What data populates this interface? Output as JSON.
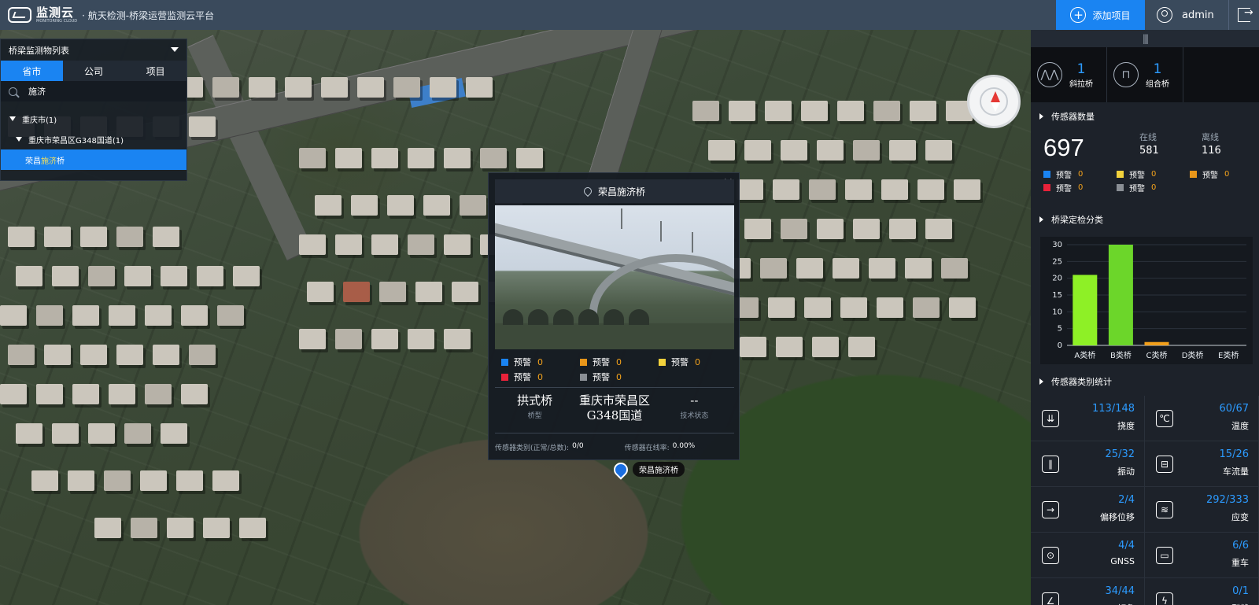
{
  "header": {
    "brand_cn": "监测云",
    "brand_en": "MONITORING CLOUD",
    "title": "· 航天检测-桥梁运营监测云平台",
    "add_project": "添加项目",
    "user": "admin"
  },
  "list_panel": {
    "title": "桥梁监测物列表",
    "tabs": [
      {
        "label": "省市",
        "active": true
      },
      {
        "label": "公司",
        "active": false
      },
      {
        "label": "项目",
        "active": false
      }
    ],
    "search_value": "施济",
    "tree": [
      {
        "level": 1,
        "label": "重庆市(1)"
      },
      {
        "level": 2,
        "label": "重庆市荣昌区G348国道(1)"
      },
      {
        "level": 3,
        "label_pre": "荣昌",
        "label_hl": "施济",
        "label_post": "桥"
      }
    ]
  },
  "popup": {
    "title": "荣昌施济桥",
    "close": "×",
    "warnings": [
      {
        "color": "#1a84f2",
        "label": "预警",
        "count": "0"
      },
      {
        "color": "#e8961a",
        "label": "预警",
        "count": "0"
      },
      {
        "color": "#f2d23c",
        "label": "预警",
        "count": "0"
      },
      {
        "color": "#e8223a",
        "label": "预警",
        "count": "0"
      },
      {
        "color": "#8a8f95",
        "label": "预警",
        "count": "0"
      }
    ],
    "bridge_type": "拱式桥",
    "bridge_type_label": "桥型",
    "location": "重庆市荣昌区G348国道",
    "tech_status": "--",
    "tech_status_label": "技术状态",
    "sensor_ratio_label": "传感器类别(正常/总数):",
    "sensor_ratio": "0/0",
    "online_rate_label": "传感器在线率:",
    "online_rate": "0.00%"
  },
  "marker": {
    "label": "荣昌施济桥"
  },
  "right": {
    "bridge_types": [
      {
        "icon": "cable-stayed-bridge-icon",
        "count": "1",
        "label": "斜拉桥"
      },
      {
        "icon": "composite-bridge-icon",
        "count": "1",
        "label": "组合桥"
      }
    ],
    "sensor_section": "传感器数量",
    "sensor_total": "697",
    "online_label": "在线",
    "online": "581",
    "offline_label": "离线",
    "offline": "116",
    "sensor_warnings": [
      {
        "color": "#1a84f2",
        "label": "预警",
        "count": "0"
      },
      {
        "color": "#f2d23c",
        "label": "预警",
        "count": "0"
      },
      {
        "color": "#e8961a",
        "label": "预警",
        "count": "0"
      },
      {
        "color": "#e8223a",
        "label": "预警",
        "count": "0"
      },
      {
        "color": "#8a8f95",
        "label": "预警",
        "count": "0"
      }
    ],
    "classify_section": "桥梁定检分类",
    "type_section": "传感器类别统计",
    "sensor_types": [
      {
        "icon": "deflection-icon",
        "value": "113/148",
        "label": "挠度"
      },
      {
        "icon": "thermometer-icon",
        "value": "60/67",
        "label": "温度"
      },
      {
        "icon": "vibration-icon",
        "value": "25/32",
        "label": "振动"
      },
      {
        "icon": "car-icon",
        "value": "15/26",
        "label": "车流量"
      },
      {
        "icon": "displacement-icon",
        "value": "2/4",
        "label": "偏移位移"
      },
      {
        "icon": "strain-icon",
        "value": "292/333",
        "label": "应变"
      },
      {
        "icon": "gnss-icon",
        "value": "4/4",
        "label": "GNSS"
      },
      {
        "icon": "truck-icon",
        "value": "6/6",
        "label": "重车"
      },
      {
        "icon": "inclination-icon",
        "value": "34/44",
        "label": "倾角"
      },
      {
        "icon": "crack-icon",
        "value": "0/1",
        "label": "裂缝"
      }
    ]
  },
  "chart_data": {
    "type": "bar",
    "categories": [
      "A类桥",
      "B类桥",
      "C类桥",
      "D类桥",
      "E类桥"
    ],
    "values": [
      21,
      30,
      1,
      0,
      0
    ],
    "colors": [
      "#8ef026",
      "#6cd62a",
      "#f2a01c",
      "#2c9bff",
      "#2c9bff"
    ],
    "ylim": [
      0,
      30
    ],
    "yticks": [
      0,
      5,
      10,
      15,
      20,
      25,
      30
    ],
    "grid": true
  }
}
